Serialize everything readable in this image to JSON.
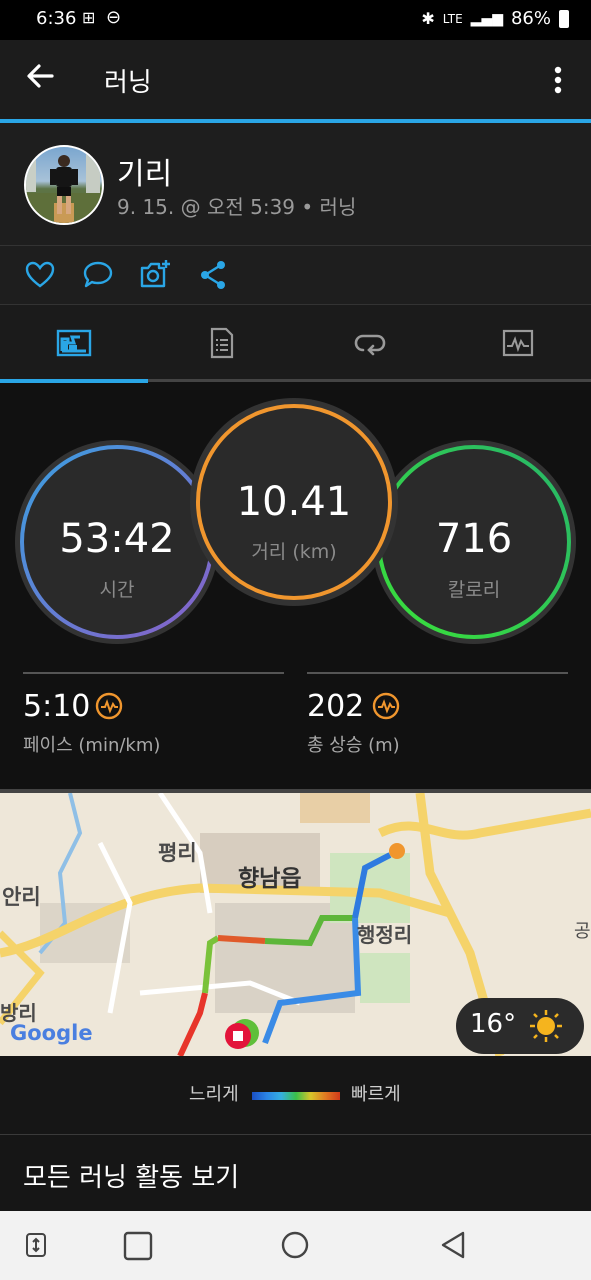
{
  "status_bar": {
    "time": "6:36",
    "battery": "86%"
  },
  "app_bar": {
    "title": "러닝"
  },
  "profile": {
    "name": "기리",
    "meta": "9. 15. @ 오전 5:39 • 러닝"
  },
  "stats": {
    "time": {
      "value": "53:42",
      "label": "시간"
    },
    "distance": {
      "value": "10.41",
      "label": "거리 (km)"
    },
    "calories": {
      "value": "716",
      "label": "칼로리"
    },
    "pace": {
      "value": "5:10",
      "label": "페이스 (min/km)"
    },
    "ascent": {
      "value": "202",
      "label": "총 상승 (m)"
    }
  },
  "map": {
    "labels": [
      "평리",
      "향남읍",
      "안리",
      "행정리",
      "방리",
      "공"
    ],
    "google": "Google",
    "weather": {
      "temp": "16°"
    }
  },
  "legend": {
    "slow": "느리게",
    "fast": "빠르게"
  },
  "view_all": "모든 러닝 활동 보기",
  "colors": {
    "accent": "#2aa6e6",
    "time_ring": "#5b7fd6",
    "distance_ring": "#f0962e",
    "calorie_ring": "#2fd24a"
  }
}
